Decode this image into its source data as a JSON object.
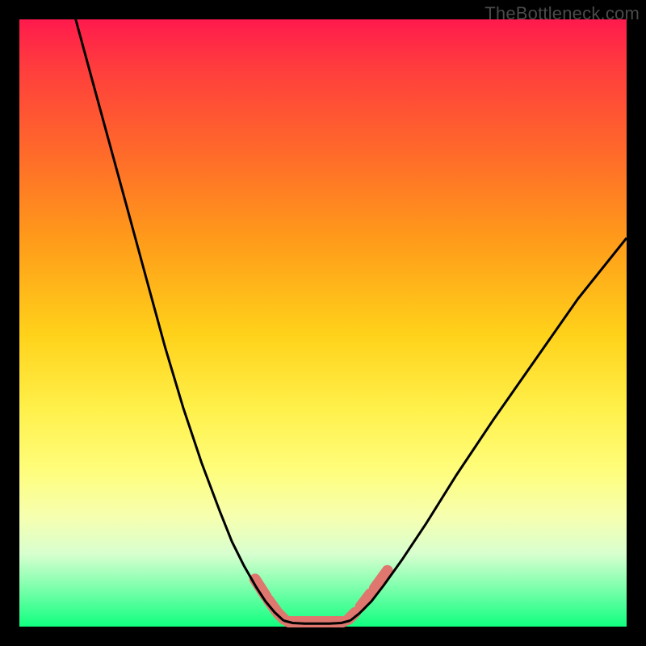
{
  "watermark": "TheBottleneck.com",
  "chart_data": {
    "type": "line",
    "title": "",
    "xlabel": "",
    "ylabel": "",
    "xlim": [
      0,
      100
    ],
    "ylim": [
      0,
      100
    ],
    "series": [
      {
        "name": "left-curve",
        "x": [
          9,
          12,
          15,
          18,
          21,
          24,
          27,
          30,
          33,
          35,
          37,
          39,
          40.5,
          42,
          43.5
        ],
        "values": [
          101,
          90,
          79,
          68,
          57,
          46,
          36,
          27,
          19,
          14,
          10,
          6.5,
          4.2,
          2.4,
          1.0
        ]
      },
      {
        "name": "flat-bottom",
        "x": [
          43.5,
          45,
          47,
          49,
          51,
          53,
          54.5
        ],
        "values": [
          1.0,
          0.6,
          0.5,
          0.5,
          0.5,
          0.6,
          1.0
        ]
      },
      {
        "name": "right-curve",
        "x": [
          54.5,
          56,
          58,
          60,
          63,
          67,
          72,
          78,
          85,
          92,
          100
        ],
        "values": [
          1.0,
          2.2,
          4.2,
          6.8,
          11,
          17,
          25,
          34,
          44,
          54,
          64
        ]
      }
    ],
    "markers": [
      {
        "name": "left-cap-upper",
        "x1": 38.8,
        "y1": 7.8,
        "x2": 40.6,
        "y2": 5.0
      },
      {
        "name": "left-cap-mid",
        "x1": 41.0,
        "y1": 4.4,
        "x2": 42.3,
        "y2": 2.6
      },
      {
        "name": "left-cap-low",
        "x1": 42.6,
        "y1": 2.2,
        "x2": 43.6,
        "y2": 1.2
      },
      {
        "name": "bottom-cap",
        "x1": 44.3,
        "y1": 0.8,
        "x2": 53.3,
        "y2": 0.8
      },
      {
        "name": "right-cap-low",
        "x1": 54.2,
        "y1": 1.2,
        "x2": 55.3,
        "y2": 2.3
      },
      {
        "name": "right-cap-mid",
        "x1": 56.2,
        "y1": 3.3,
        "x2": 57.8,
        "y2": 5.4
      },
      {
        "name": "right-cap-upper",
        "x1": 58.5,
        "y1": 6.3,
        "x2": 60.6,
        "y2": 9.2
      }
    ],
    "background_gradient": [
      "#ff1a4d",
      "#ff6a2a",
      "#ffd21a",
      "#fffd7a",
      "#10ff80"
    ]
  }
}
